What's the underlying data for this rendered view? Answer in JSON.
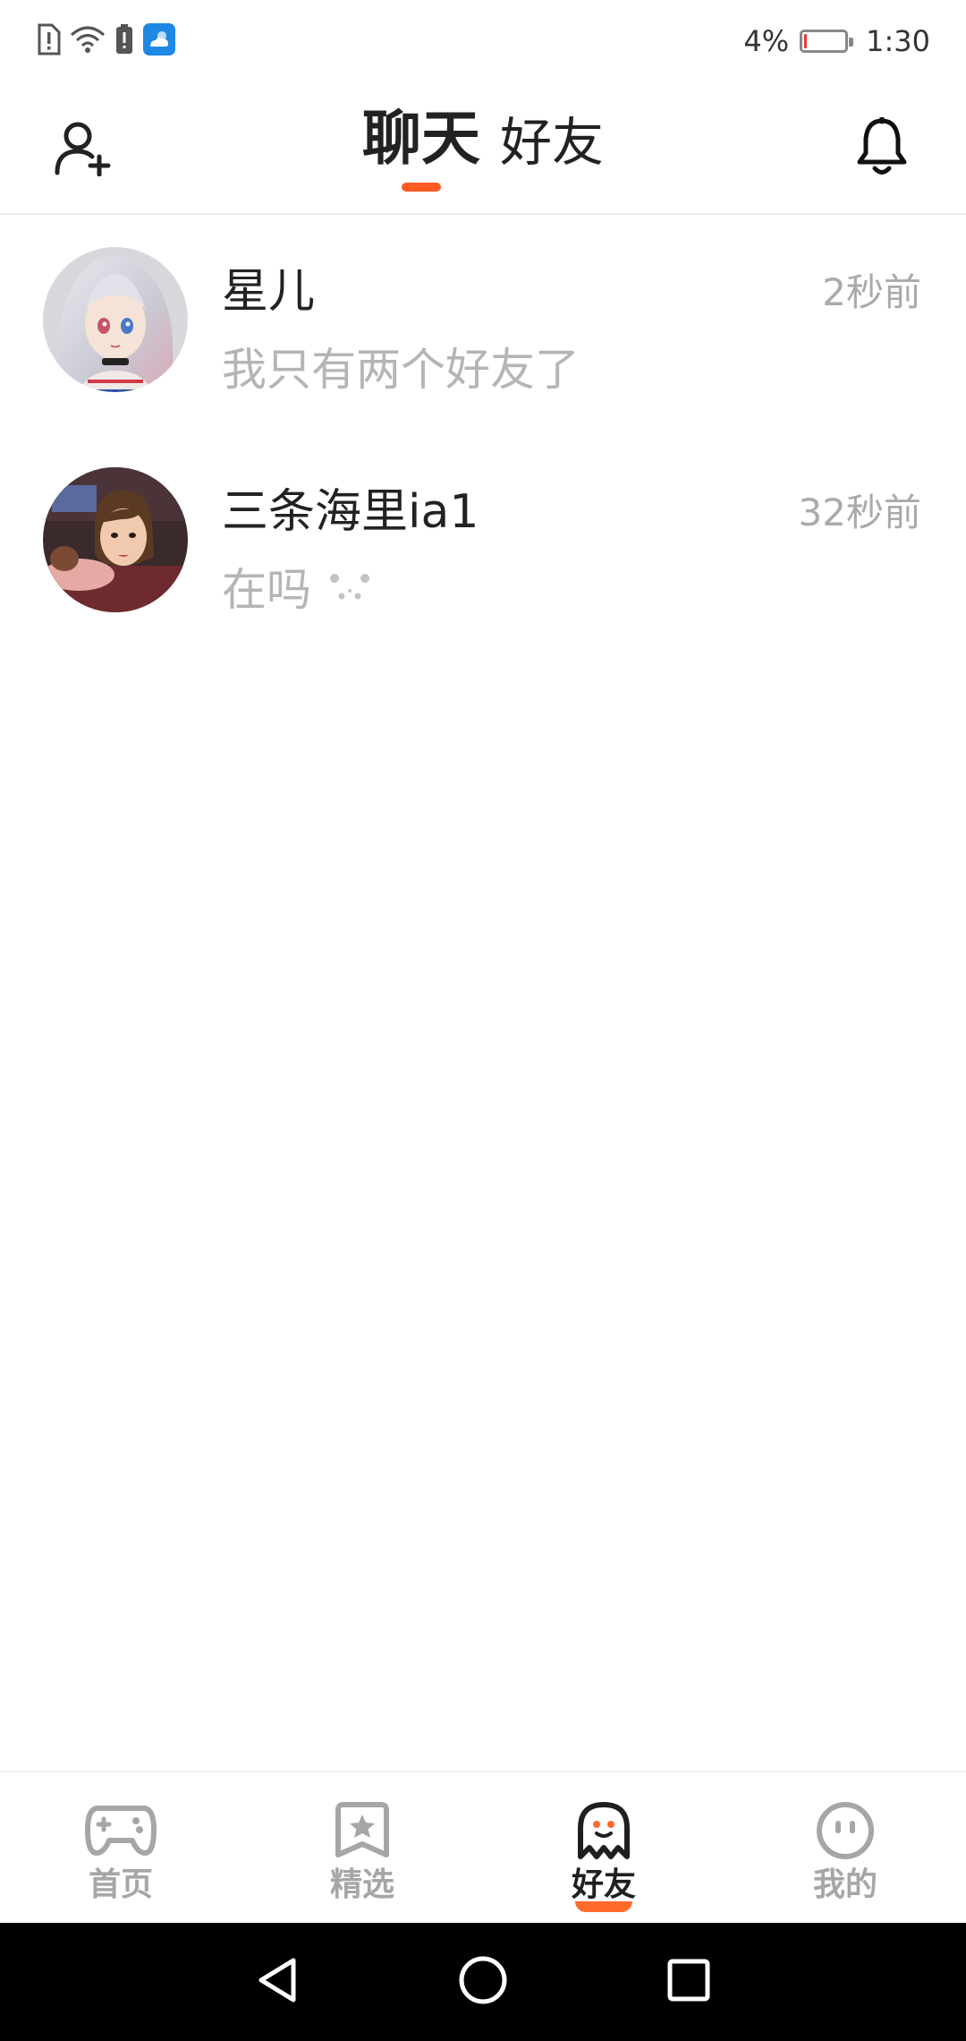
{
  "status_bar": {
    "battery_percent": "4%",
    "time": "1:30",
    "battery_level": 0.04,
    "icons": [
      "sim-alert-icon",
      "wifi-icon",
      "battery-alert-icon",
      "weather-app-icon"
    ]
  },
  "header": {
    "tabs": [
      {
        "label": "聊天",
        "active": true
      },
      {
        "label": "好友",
        "active": false
      }
    ],
    "left_icon": "add-friend-icon",
    "right_icon": "bell-icon"
  },
  "chats": [
    {
      "name": "星儿",
      "time": "2秒前",
      "preview": "我只有两个好友了"
    },
    {
      "name": "三条海里ia1",
      "time": "32秒前",
      "preview": "在吗"
    }
  ],
  "bottom_nav": {
    "items": [
      {
        "label": "首页",
        "icon": "gamepad-icon",
        "active": false
      },
      {
        "label": "精选",
        "icon": "star-bookmark-icon",
        "active": false
      },
      {
        "label": "好友",
        "icon": "ghost-icon",
        "active": true
      },
      {
        "label": "我的",
        "icon": "face-icon",
        "active": false
      }
    ]
  },
  "colors": {
    "accent": "#ff5a1f",
    "text_primary": "#222222",
    "text_secondary": "#b5b5b5",
    "nav_inactive": "#a6a6a6"
  }
}
